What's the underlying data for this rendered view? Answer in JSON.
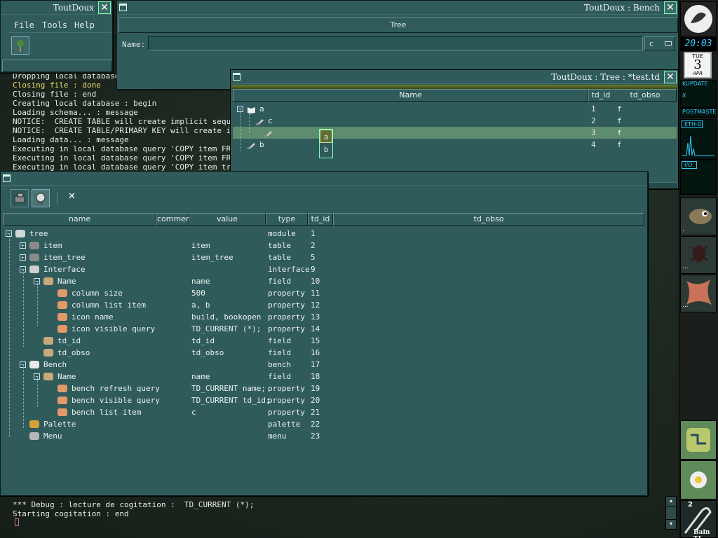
{
  "toutdoux_main": {
    "title": "ToutDoux",
    "close": "✕",
    "menu": [
      "File",
      "Tools",
      "Help"
    ]
  },
  "terminal": {
    "lines": [
      {
        "t": "Dropping local database",
        "c": "#e8ece8"
      },
      {
        "t": "Closing file : done",
        "c": "#e8d860"
      },
      {
        "t": "Closing file : end",
        "c": "#e8ece8"
      },
      {
        "t": "Creating local database : begin",
        "c": "#e8ece8"
      },
      {
        "t": "Loading schema... : message",
        "c": "#e8ece8"
      },
      {
        "t": "NOTICE:  CREATE TABLE will create implicit sequence",
        "c": "#e8ece8"
      },
      {
        "t": "NOTICE:  CREATE TABLE/PRIMARY KEY will create impli",
        "c": "#e8ece8"
      },
      {
        "t": "Loading data... : message",
        "c": "#e8ece8"
      },
      {
        "t": "Executing in local database query 'COPY item FROM s",
        "c": "#e8ece8"
      },
      {
        "t": "Executing in local database query 'COPY item FROM s",
        "c": "#e8ece8"
      },
      {
        "t": "Executing in local database query 'COPY item tree F",
        "c": "#e8ece8"
      }
    ],
    "bottom_lines": [
      "*** Debug : lecture de cogitation :  TD_CURRENT (*);",
      "Starting cogitation : end"
    ]
  },
  "bench": {
    "title": "ToutDoux : Bench",
    "close": "✕",
    "tree_label": "Tree",
    "name_label": "Name:",
    "name_value": "",
    "c_label": "c"
  },
  "tree_win": {
    "title": "ToutDoux : Tree : *test.td",
    "close": "✕",
    "headers": [
      "Name",
      "td_id",
      "td_obso"
    ],
    "rows": [
      {
        "name": "a",
        "id": "1",
        "obso": "f"
      },
      {
        "name": "c",
        "id": "2",
        "obso": "f"
      },
      {
        "name": "",
        "id": "3",
        "obso": "f"
      },
      {
        "name": "b",
        "id": "4",
        "obso": "f"
      }
    ],
    "popup": [
      "a",
      "b"
    ]
  },
  "schema_win": {
    "toolbar_close": "✕",
    "headers": [
      "name",
      "comment",
      "value",
      "type",
      "td_id",
      "td_obso"
    ],
    "rows": [
      {
        "n": "tree",
        "v": "",
        "t": "module",
        "id": "1",
        "d": 0,
        "ic": "module"
      },
      {
        "n": "item",
        "v": "item",
        "t": "table",
        "id": "2",
        "d": 1,
        "ic": "table"
      },
      {
        "n": "item_tree",
        "v": "item_tree",
        "t": "table",
        "id": "5",
        "d": 1,
        "ic": "table"
      },
      {
        "n": "Interface",
        "v": "",
        "t": "interface",
        "id": "9",
        "d": 1,
        "ic": "interface"
      },
      {
        "n": "Name",
        "v": "name",
        "t": "field",
        "id": "10",
        "d": 2,
        "ic": "field"
      },
      {
        "n": "column size",
        "v": "500",
        "t": "property",
        "id": "11",
        "d": 3,
        "ic": "property"
      },
      {
        "n": "column list item",
        "v": "a, b",
        "t": "property",
        "id": "12",
        "d": 3,
        "ic": "property"
      },
      {
        "n": "icon name",
        "v": "build, bookopen",
        "t": "property",
        "id": "13",
        "d": 3,
        "ic": "property"
      },
      {
        "n": "icon visible query",
        "v": "TD_CURRENT (*);",
        "t": "property",
        "id": "14",
        "d": 3,
        "ic": "property"
      },
      {
        "n": "td_id",
        "v": "td_id",
        "t": "field",
        "id": "15",
        "d": 2,
        "ic": "field"
      },
      {
        "n": "td_obso",
        "v": "td_obso",
        "t": "field",
        "id": "16",
        "d": 2,
        "ic": "field"
      },
      {
        "n": "Bench",
        "v": "",
        "t": "bench",
        "id": "17",
        "d": 1,
        "ic": "bench"
      },
      {
        "n": "Name",
        "v": "name",
        "t": "field",
        "id": "18",
        "d": 2,
        "ic": "field"
      },
      {
        "n": "bench refresh query",
        "v": "TD_CURRENT name;",
        "t": "property",
        "id": "19",
        "d": 3,
        "ic": "property"
      },
      {
        "n": "bench visible query",
        "v": "TD_CURRENT td_id;",
        "t": "property",
        "id": "20",
        "d": 3,
        "ic": "property"
      },
      {
        "n": "bench list item",
        "v": "c",
        "t": "property",
        "id": "21",
        "d": 3,
        "ic": "property"
      },
      {
        "n": "Palette",
        "v": "",
        "t": "palette",
        "id": "22",
        "d": 1,
        "ic": "palette"
      },
      {
        "n": "Menu",
        "v": "",
        "t": "menu",
        "id": "23",
        "d": 1,
        "ic": "menu"
      }
    ]
  },
  "dock": {
    "clock": "20:03",
    "day": "TUE",
    "date": "3",
    "month": "APR",
    "kupdate": "KUPDATE",
    "postmaster": "POSTMASTE",
    "eth": "ETH-0",
    "io": "I/O",
    "x": "X",
    "desk_num": "2",
    "bain": "Bain TI",
    "dots": "..."
  },
  "colors": {
    "panel": "#2f5b5b",
    "selected": "#5e8c6e",
    "popup_sel": "#6a7a3a"
  }
}
